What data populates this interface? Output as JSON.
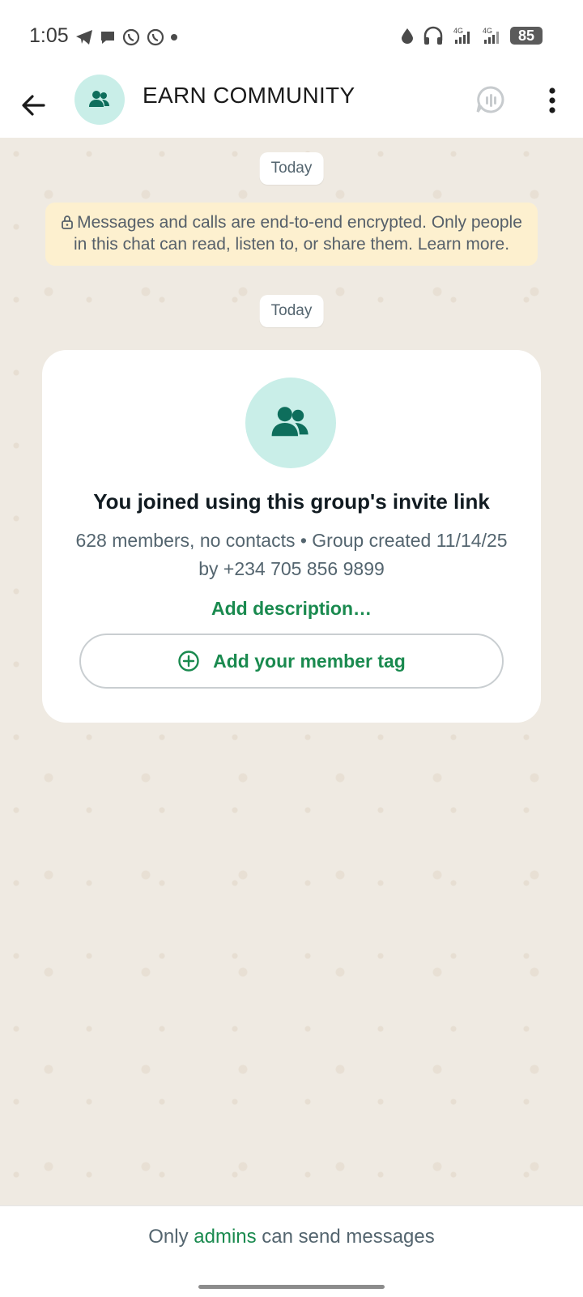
{
  "status_bar": {
    "time": "1:05",
    "battery": "85",
    "network_1": "4G",
    "network_2": "4G",
    "left_icons": [
      "telegram-icon",
      "chat-bubble-icon",
      "whatsapp-icon",
      "whatsapp-icon",
      "dot-icon"
    ],
    "right_icons": [
      "water-drop-icon",
      "headphones-icon",
      "signal-4g-icon",
      "signal-4g-icon",
      "battery-icon"
    ]
  },
  "header": {
    "title": "EARN COMMUNITY",
    "back_icon": "arrow-back-icon",
    "avatar_icon": "group-icon",
    "call_icon": "voice-chat-icon",
    "menu_icon": "more-vert-icon"
  },
  "chat": {
    "date_chip_1": "Today",
    "encryption_notice": "Messages and calls are end-to-end encrypted. Only people in this chat can read, listen to, or share them. Learn more.",
    "date_chip_2": "Today",
    "group_card": {
      "title": "You joined using this group's invite link",
      "meta": "628 members, no contacts • Group created 11/14/25 by +234 705 856 9899",
      "add_description": "Add description…",
      "member_tag_button": "Add your member tag"
    }
  },
  "footer": {
    "prefix": "Only ",
    "link": "admins",
    "suffix": " can send messages"
  },
  "colors": {
    "accent_green": "#1a8a4f",
    "avatar_bg": "#c9eee8",
    "avatar_fg": "#0e6e5c",
    "notice_bg": "#fdf0cf",
    "chat_bg": "#efeae2"
  }
}
